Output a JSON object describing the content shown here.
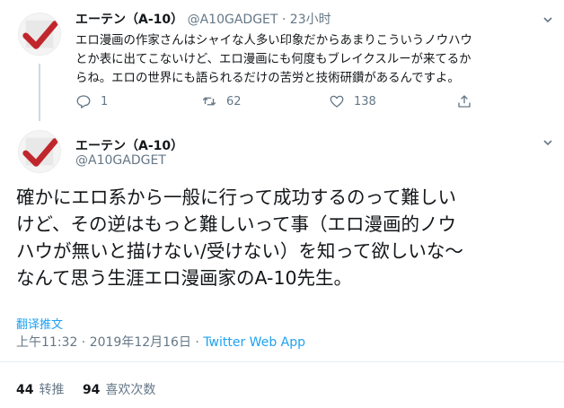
{
  "tweet1": {
    "name": "エーテン（A-10）",
    "handle": "@A10GADGET",
    "separator": "·",
    "time": "23小时",
    "lines": [
      "エロ漫画の作家さんはシャイな人多い印象だからあまりこういうノウハウ",
      "とか表に出てこないけど、エロ漫画にも何度もブレイクスルーが来てるか",
      "らね。エロの世界にも語られるだけの苦労と技術研鑽があるんですよ。"
    ],
    "reply_count": "1",
    "retweet_count": "62",
    "like_count": "138",
    "icons": [
      "reply-icon",
      "retweet-icon",
      "like-icon",
      "share-icon",
      "chevron-down-icon"
    ]
  },
  "tweet2": {
    "name": "エーテン（A-10）",
    "handle": "@A10GADGET",
    "lines": [
      "確かにエロ系から一般に行って成功するのって難しい",
      "けど、その逆はもっと難しいって事（エロ漫画的ノウ",
      "ハウが無いと描けない/受けない）を知って欲しいな～",
      "なんて思う生涯エロ漫画家のA-10先生。"
    ],
    "translate_label": "翻译推文",
    "datetime": "上午11:32 · 2019年12月16日 · ",
    "source": "Twitter Web App",
    "retweets_value": "44",
    "retweets_label": "转推",
    "likes_value": "94",
    "likes_label": "喜欢次数"
  },
  "colors": {
    "accent": "#1da1f2",
    "secondary_text": "#657786",
    "avatar_red": "#c0272d"
  }
}
